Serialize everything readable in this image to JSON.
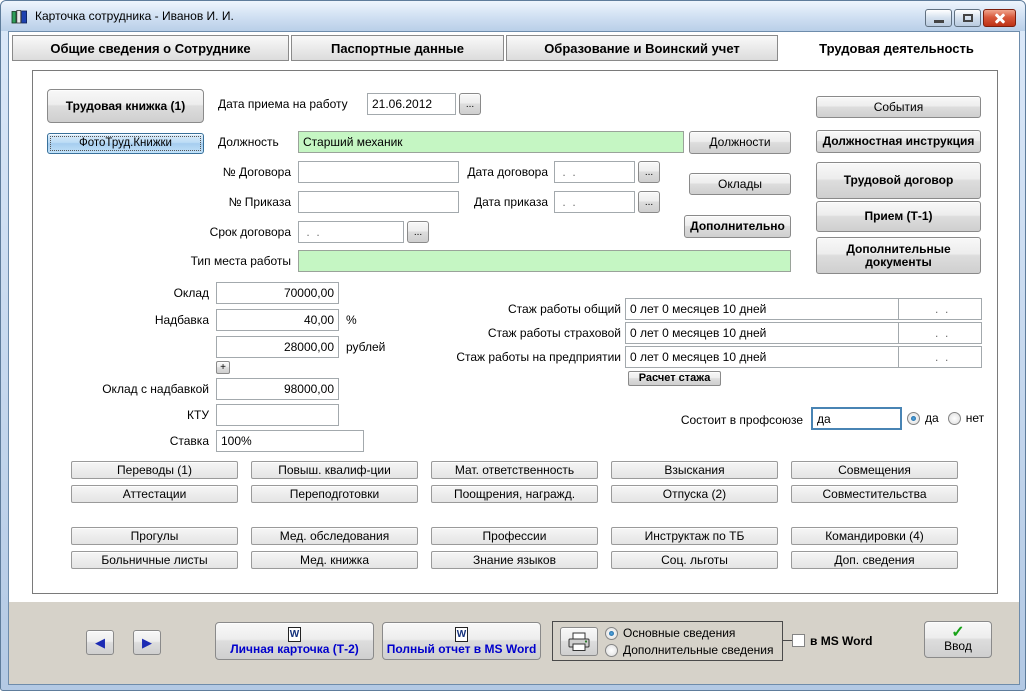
{
  "window": {
    "title": "Карточка сотрудника -  Иванов И. И."
  },
  "tabs": [
    {
      "label": "Общие сведения о Сотруднике",
      "active": false
    },
    {
      "label": "Паспортные данные",
      "active": false
    },
    {
      "label": "Образование и Воинский учет",
      "active": false
    },
    {
      "label": "Трудовая деятельность",
      "active": true
    }
  ],
  "left_buttons": {
    "workbook": "Трудовая книжка (1)",
    "photo": "ФотоТруд.Книжки"
  },
  "form": {
    "hire_date": {
      "label": "Дата приема на работу",
      "value": "21.06.2012",
      "browse": "..."
    },
    "position": {
      "label": "Должность",
      "value": "Старший механик",
      "button": "Должности"
    },
    "contract_no": {
      "label": "№ Договора",
      "value": ""
    },
    "contract_date": {
      "label": "Дата договора",
      "value": " .  .",
      "browse": "..."
    },
    "order_no": {
      "label": "№ Приказа",
      "value": ""
    },
    "order_date": {
      "label": "Дата приказа",
      "value": " .  .",
      "browse": "..."
    },
    "contract_term": {
      "label": "Срок договора",
      "value": " .  .",
      "browse": "..."
    },
    "workplace_type": {
      "label": "Тип места работы",
      "value": ""
    },
    "salaries_button": "Оклады",
    "additional_button": "Дополнительно"
  },
  "right_buttons": {
    "events": "События",
    "job_instruction": "Должностная инструкция",
    "labor_contract": "Трудовой  договор",
    "hiring_t1": "Прием (Т-1)",
    "additional_docs": "Дополнительные документы"
  },
  "salary": {
    "oklad": {
      "label": "Оклад",
      "value": "70000,00"
    },
    "bonus_pct": {
      "label": "Надбавка",
      "value": "40,00",
      "unit": "%"
    },
    "bonus_rub": {
      "value": "28000,00",
      "unit": "рублей"
    },
    "plus_button": "+",
    "total": {
      "label": "Оклад с надбавкой",
      "value": "98000,00"
    },
    "ktu": {
      "label": "КТУ",
      "value": ""
    },
    "rate": {
      "label": "Ставка",
      "value": "100%"
    }
  },
  "experience": {
    "rows": [
      {
        "label": "Стаж работы общий",
        "value": "0 лет 0 месяцев 10 дней",
        "date": " .  ."
      },
      {
        "label": "Стаж работы страховой",
        "value": "0 лет 0 месяцев 10 дней",
        "date": " .  ."
      },
      {
        "label": "Стаж работы на предприятии",
        "value": "0 лет 0 месяцев 10 дней",
        "date": " .  ."
      }
    ],
    "calc_button": "Расчет стажа"
  },
  "union": {
    "label": "Состоит в профсоюзе",
    "value": "да",
    "radio_yes": "да",
    "radio_no": "нет"
  },
  "grid": [
    [
      "Переводы (1)",
      "Повыш. квалиф-ции",
      "Мат. ответственность",
      "Взыскания",
      "Совмещения"
    ],
    [
      "Аттестации",
      "Переподготовки",
      "Поощрения, награжд.",
      "Отпуска (2)",
      "Совместительства"
    ],
    [
      "Прогулы",
      "Мед. обследования",
      "Профессии",
      "Инструктаж по ТБ",
      "Командировки (4)"
    ],
    [
      "Больничные листы",
      "Мед. книжка",
      "Знание языков",
      "Соц. льготы",
      "Доп. сведения"
    ]
  ],
  "bottom": {
    "personal_card": "Личная карточка (Т-2)",
    "full_report": "Полный отчет в MS Word",
    "radio_main": "Основные сведения",
    "radio_additional": "Дополнительные сведения",
    "word_checkbox": "в MS Word",
    "enter_button": "Ввод"
  },
  "icons": {
    "word_glyph": "W",
    "check_glyph": "✓",
    "arrow_left": "◀",
    "arrow_right": "▶"
  },
  "colors": {
    "field_green": "#c5f6c3",
    "focus_blue": "#4884b4",
    "link_blue": "#0000cc",
    "titlebar_blue": "#cfdff2"
  }
}
